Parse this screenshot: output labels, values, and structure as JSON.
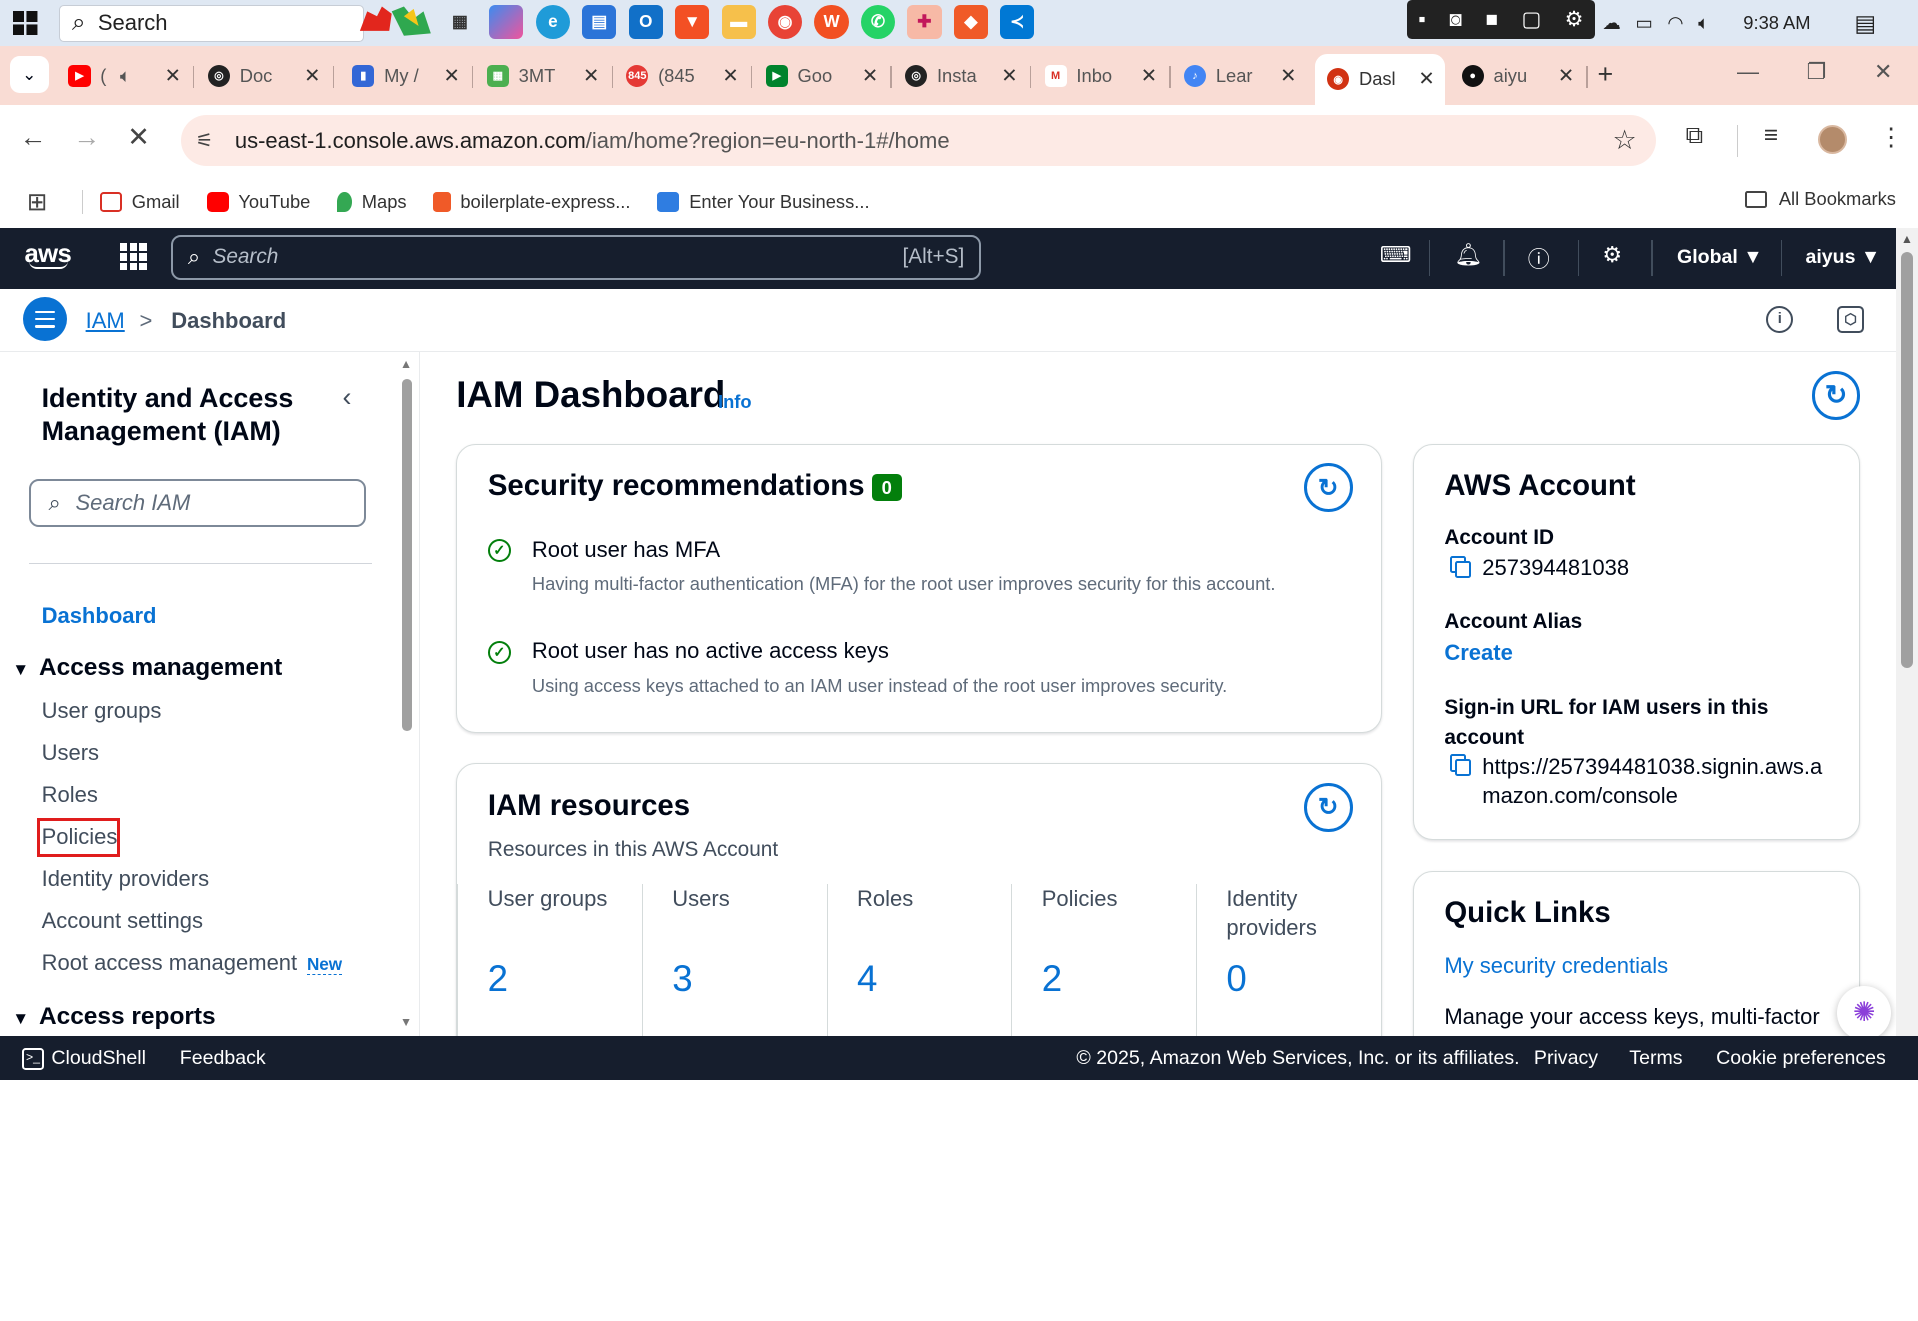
{
  "taskbar": {
    "search_placeholder": "Search",
    "clock": "9:38 AM"
  },
  "tabs": [
    {
      "label": "(",
      "icon": "youtube-icon"
    },
    {
      "label": "Doc",
      "icon": "openai-icon"
    },
    {
      "label": "My /",
      "icon": "doc-icon"
    },
    {
      "label": "3MT",
      "icon": "grid-app-icon"
    },
    {
      "label": "(845",
      "icon": "notification-badge-icon"
    },
    {
      "label": "Goo",
      "icon": "google-meet-icon"
    },
    {
      "label": "Insta",
      "icon": "openai-icon"
    },
    {
      "label": "Inbo",
      "icon": "gmail-icon"
    },
    {
      "label": "Lear",
      "icon": "learn-icon"
    },
    {
      "label": "Dasl",
      "icon": "aws-console-icon",
      "active": true
    },
    {
      "label": "aiyu",
      "icon": "github-icon"
    }
  ],
  "address": {
    "url_host": "us-east-1.console.aws.amazon.com",
    "url_path": "/iam/home?region=eu-north-1#/home"
  },
  "bookmarks": {
    "items": [
      "Gmail",
      "YouTube",
      "Maps",
      "boilerplate-express...",
      "Enter Your Business..."
    ],
    "all_label": "All Bookmarks"
  },
  "aws_nav": {
    "logo": "aws",
    "search_placeholder": "Search",
    "search_shortcut": "[Alt+S]",
    "region": "Global ▼",
    "user": "aiyus ▼"
  },
  "breadcrumb": {
    "root": "IAM",
    "separator": ">",
    "current": "Dashboard"
  },
  "sidebar": {
    "title": "Identity and Access Management (IAM)",
    "search_placeholder": "Search IAM",
    "dashboard": "Dashboard",
    "access_management": "Access management",
    "items": [
      "User groups",
      "Users",
      "Roles",
      "Policies",
      "Identity providers",
      "Account settings",
      "Root access management"
    ],
    "new_badge": "New",
    "access_reports": "Access reports"
  },
  "main": {
    "title": "IAM Dashboard",
    "info": "Info",
    "security": {
      "title": "Security recommendations",
      "count": "0",
      "recs": [
        {
          "title": "Root user has MFA",
          "desc": "Having multi-factor authentication (MFA) for the root user improves security for this account."
        },
        {
          "title": "Root user has no active access keys",
          "desc": "Using access keys attached to an IAM user instead of the root user improves security."
        }
      ]
    },
    "resources": {
      "title": "IAM resources",
      "subtitle": "Resources in this AWS Account",
      "items": [
        {
          "label": "User groups",
          "value": "2"
        },
        {
          "label": "Users",
          "value": "3"
        },
        {
          "label": "Roles",
          "value": "4"
        },
        {
          "label": "Policies",
          "value": "2"
        },
        {
          "label": "Identity providers",
          "value": "0"
        }
      ]
    },
    "account": {
      "title": "AWS Account",
      "id_label": "Account ID",
      "id_value": "257394481038",
      "alias_label": "Account Alias",
      "alias_action": "Create",
      "signin_label": "Sign-in URL for IAM users in this account",
      "signin_url": "https://257394481038.signin.aws.amazon.com/console"
    },
    "quick_links": {
      "title": "Quick Links",
      "link1": "My security credentials",
      "text1": "Manage your access keys, multi-factor"
    }
  },
  "footer": {
    "cloudshell": "CloudShell",
    "feedback": "Feedback",
    "copyright": "© 2025, Amazon Web Services, Inc. or its affiliates.",
    "privacy": "Privacy",
    "terms": "Terms",
    "cookies": "Cookie preferences"
  },
  "colors": {
    "aws_nav_bg": "#161e2d",
    "link_blue": "#0972d3",
    "success_green": "#037f0c",
    "highlight_red": "#e01d1d",
    "tabbar_bg": "#f9dcd4"
  }
}
